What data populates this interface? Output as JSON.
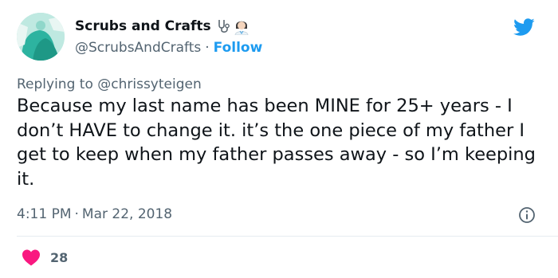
{
  "author": {
    "display_name": "Scrubs and Crafts",
    "name_emojis": [
      "stethoscope-emoji",
      "health-worker-emoji"
    ],
    "handle": "@ScrubsAndCrafts",
    "separator": "·",
    "follow_label": "Follow"
  },
  "reply": {
    "prefix": "Replying to",
    "mention": "@chrissyteigen"
  },
  "tweet": {
    "text": "Because my last name has been MINE for 25+ years - I don’t HAVE to change it. it’s the one piece of my father I get to keep when my father passes away - so I’m keeping it."
  },
  "meta": {
    "time": "4:11 PM",
    "separator": "·",
    "date": "Mar 22, 2018"
  },
  "engagement": {
    "likes": "28"
  },
  "colors": {
    "brand_blue": "#1d9bf0",
    "like_red": "#f91880",
    "secondary_text": "#536471",
    "primary_text": "#0f1419"
  },
  "icons": {
    "platform": "twitter-bird-icon",
    "info": "info-icon",
    "like": "heart-icon"
  }
}
